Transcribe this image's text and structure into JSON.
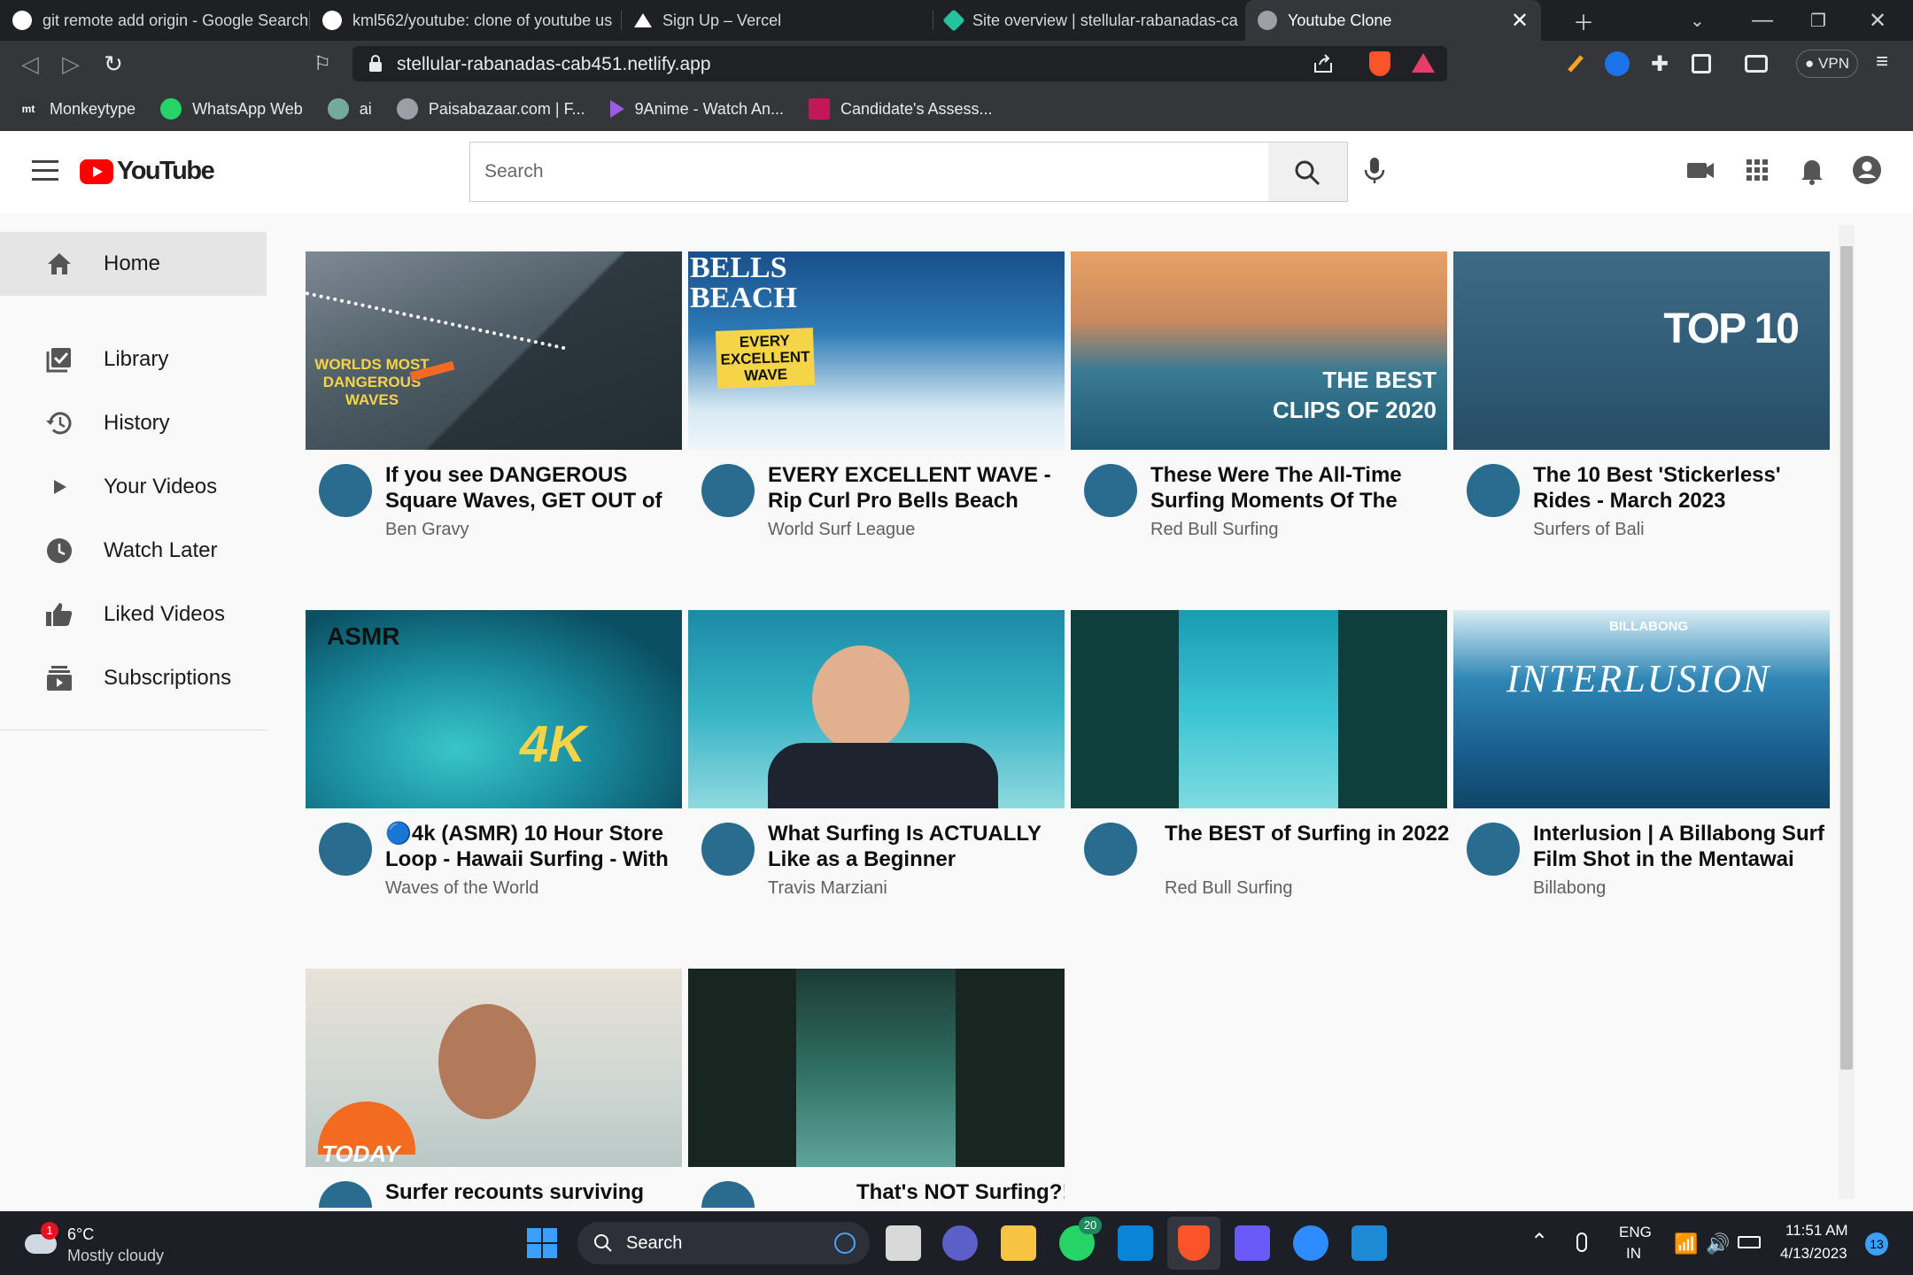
{
  "browser": {
    "tabs": [
      {
        "title": "git remote add origin - Google Search",
        "favicon_color": "#ffffff"
      },
      {
        "title": "kml562/youtube: clone of youtube us",
        "favicon_color": "#ffffff"
      },
      {
        "title": "Sign Up – Vercel",
        "favicon_color": "#ffffff"
      },
      {
        "title": "Site overview | stellular-rabanadas-ca",
        "favicon_color": "#25c2a0"
      },
      {
        "title": "Youtube Clone",
        "favicon_color": "#9aa0a6"
      }
    ],
    "url": "stellular-rabanadas-cab451.netlify.app",
    "vpn_label": "VPN",
    "bookmarks": [
      {
        "label": "Monkeytype",
        "icon": "mt"
      },
      {
        "label": "WhatsApp Web",
        "icon": "whatsapp-icon"
      },
      {
        "label": "ai",
        "icon": "openai-icon"
      },
      {
        "label": "Paisabazaar.com | F...",
        "icon": "globe-icon"
      },
      {
        "label": "9Anime - Watch An...",
        "icon": "play-icon"
      },
      {
        "label": "Candidate's Assess...",
        "icon": "assess-icon"
      }
    ]
  },
  "header": {
    "logo_text": "YouTube",
    "search_placeholder": "Search"
  },
  "sidebar": {
    "items": [
      {
        "label": "Home",
        "icon": "home-icon"
      },
      {
        "label": "Library",
        "icon": "library-icon"
      },
      {
        "label": "History",
        "icon": "history-icon"
      },
      {
        "label": "Your Videos",
        "icon": "play-icon"
      },
      {
        "label": "Watch Later",
        "icon": "clock-icon"
      },
      {
        "label": "Liked Videos",
        "icon": "thumbs-up-icon"
      },
      {
        "label": "Subscriptions",
        "icon": "subscriptions-icon"
      }
    ]
  },
  "videos": [
    {
      "title": "If you see DANGEROUS Square Waves, GET OUT of",
      "channel": "Ben Gravy",
      "overlay": "WORLDS MOST DANGEROUS WAVES"
    },
    {
      "title": "EVERY EXCELLENT WAVE - Rip Curl Pro Bells Beach",
      "channel": "World Surf League",
      "overlay": "EVERY EXCELLENT WAVE"
    },
    {
      "title": "These Were The All-Time Surfing Moments Of The Year",
      "channel": "Red Bull Surfing",
      "overlay": "THE BEST CLIPS OF 2020"
    },
    {
      "title": "The 10 Best 'Stickerless' Rides - March 2023",
      "channel": "Surfers of Bali",
      "overlay": "TOP 10"
    },
    {
      "title": "🔵4k (ASMR) 10 Hour Store Loop - Hawaii Surfing - With",
      "channel": "Waves of the World",
      "overlay": "4K"
    },
    {
      "title": "What Surfing Is ACTUALLY Like as a Beginner",
      "channel": "Travis Marziani",
      "overlay": ""
    },
    {
      "title": "The BEST of Surfing in 2022",
      "channel": "Red Bull Surfing",
      "overlay": ""
    },
    {
      "title": "Interlusion | A Billabong Surf Film Shot in the Mentawai",
      "channel": "Billabong",
      "overlay": "INTERLUSION"
    },
    {
      "title": "Surfer recounts surviving",
      "channel": "",
      "overlay": "TODAY"
    },
    {
      "title": "That's NOT Surfing?!",
      "channel": "",
      "overlay": ""
    }
  ],
  "taskbar": {
    "weather_temp": "6°C",
    "weather_desc": "Mostly cloudy",
    "weather_badge": "1",
    "search_label": "Search",
    "whatsapp_badge": "20",
    "lang_top": "ENG",
    "lang_bottom": "IN",
    "time": "11:51 AM",
    "date": "4/13/2023",
    "notif_count": "13"
  }
}
